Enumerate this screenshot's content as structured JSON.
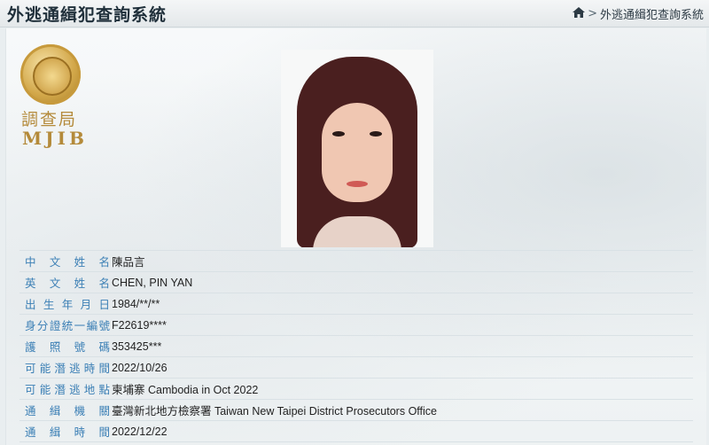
{
  "header": {
    "title": "外逃通緝犯查詢系統",
    "breadcrumb": {
      "separator": ">",
      "current": "外逃通緝犯查詢系統"
    }
  },
  "logo": {
    "org_cn": "調查局",
    "org_en": "MJIB"
  },
  "icons": {
    "home": "home-icon",
    "seal": "seal-emblem-icon"
  },
  "fugitive": {
    "fields": [
      {
        "label": "中文姓名",
        "value": "陳品言"
      },
      {
        "label": "英文姓名",
        "value": "CHEN, PIN YAN"
      },
      {
        "label": "出生年月日",
        "value": "1984/**/**"
      },
      {
        "label": "身分證統一編號",
        "value": "F22619****"
      },
      {
        "label": "護照號碼",
        "value": "353425***"
      },
      {
        "label": "可能潛逃時間",
        "value": "2022/10/26"
      },
      {
        "label": "可能潛逃地點",
        "value": "柬埔寨 Cambodia in Oct 2022"
      },
      {
        "label": "通緝機關",
        "value": "臺灣新北地方檢察署 Taiwan New Taipei District Prosecutors Office"
      },
      {
        "label": "通緝時間",
        "value": "2022/12/22"
      }
    ]
  },
  "colors": {
    "label": "#3b7fb5",
    "accent_gold": "#b48a3a"
  }
}
